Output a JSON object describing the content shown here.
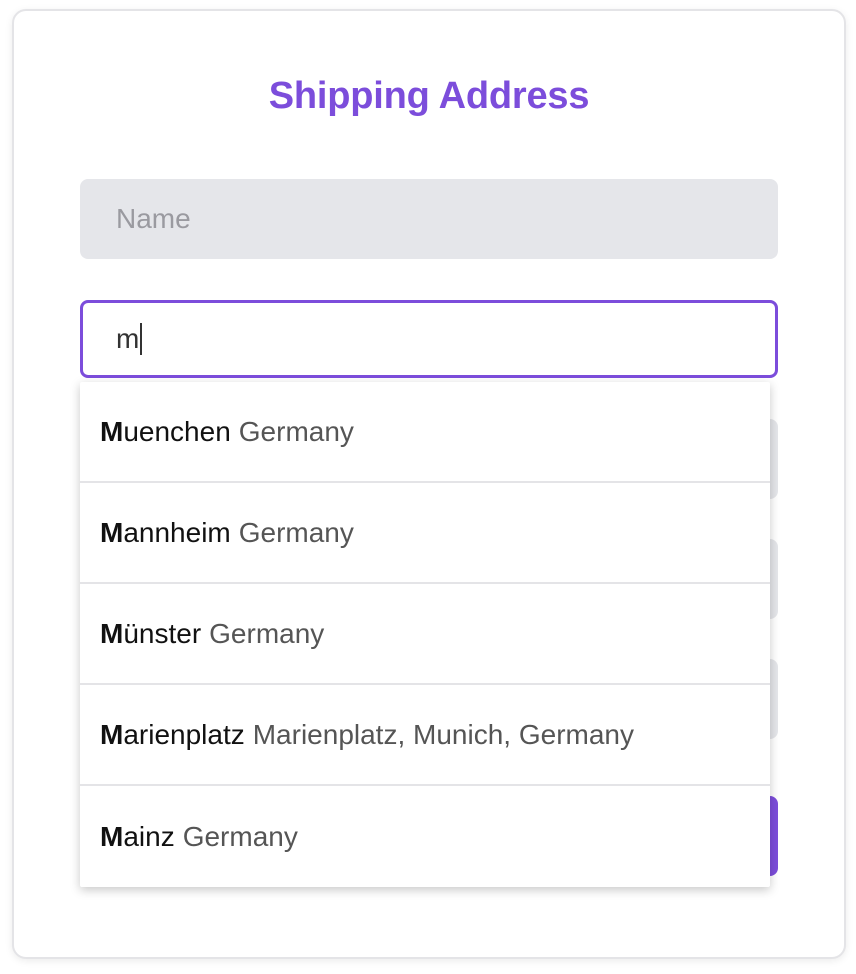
{
  "form": {
    "title": "Shipping Address",
    "name_placeholder": "Name",
    "city_value": "m"
  },
  "suggestions": [
    {
      "match": "M",
      "rest": "uenchen",
      "secondary": "Germany"
    },
    {
      "match": "M",
      "rest": "annheim",
      "secondary": "Germany"
    },
    {
      "match": "M",
      "rest": "ünster",
      "secondary": "Germany"
    },
    {
      "match": "M",
      "rest": "arienplatz",
      "secondary": "Marienplatz, Munich, Germany"
    },
    {
      "match": "M",
      "rest": "ainz",
      "secondary": "Germany"
    }
  ],
  "colors": {
    "accent": "#7c4ddb",
    "field_bg": "#e5e6ea"
  }
}
